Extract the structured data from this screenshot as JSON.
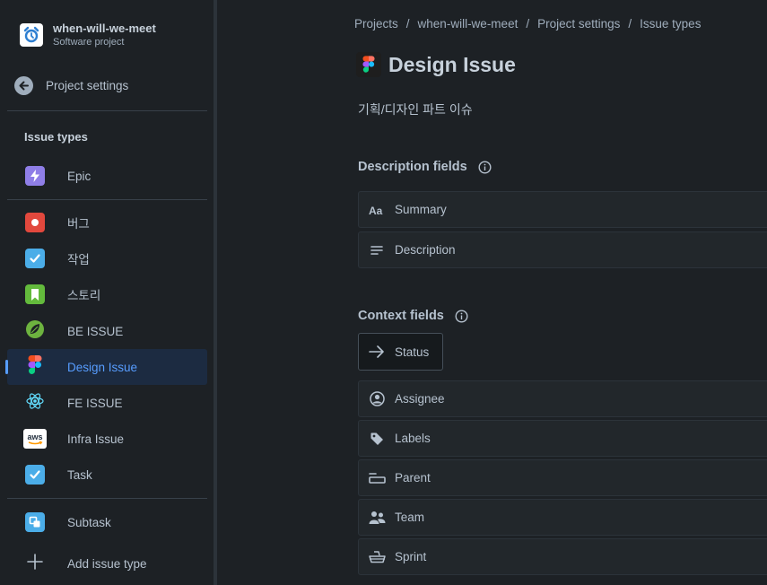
{
  "project": {
    "name": "when-will-we-meet",
    "type": "Software project"
  },
  "sidebar": {
    "back_label": "Project settings",
    "section_title": "Issue types",
    "items": [
      {
        "label": "Epic",
        "icon": "lightning-icon",
        "color": "#8f7ee7"
      },
      {
        "label": "버그",
        "icon": "bug-icon",
        "color": "#e2483d"
      },
      {
        "label": "작업",
        "icon": "checkbox-icon",
        "color": "#4bade8"
      },
      {
        "label": "스토리",
        "icon": "bookmark-icon",
        "color": "#63ba3c"
      },
      {
        "label": "BE ISSUE",
        "icon": "spring-leaf-icon",
        "color": "#6db33f"
      },
      {
        "label": "Design Issue",
        "icon": "figma-icon",
        "selected": true
      },
      {
        "label": "FE ISSUE",
        "icon": "react-icon",
        "color": "#61dafb"
      },
      {
        "label": "Infra Issue",
        "icon": "aws-icon"
      },
      {
        "label": "Task",
        "icon": "checkbox-icon",
        "color": "#4bade8"
      },
      {
        "label": "Subtask",
        "icon": "subtask-icon",
        "color": "#4bade8"
      }
    ],
    "add_label": "Add issue type"
  },
  "breadcrumb": [
    "Projects",
    "when-will-we-meet",
    "Project settings",
    "Issue types"
  ],
  "page": {
    "title": "Design Issue",
    "description": "기획/디자인 파트 이슈"
  },
  "description_fields": {
    "title": "Description fields",
    "items": [
      {
        "label": "Summary",
        "icon": "text-aa-icon"
      },
      {
        "label": "Description",
        "icon": "text-lines-icon"
      }
    ]
  },
  "context_fields": {
    "title": "Context fields",
    "status_label": "Status",
    "items": [
      {
        "label": "Assignee",
        "icon": "person-icon"
      },
      {
        "label": "Labels",
        "icon": "tag-icon"
      },
      {
        "label": "Parent",
        "icon": "parent-icon"
      },
      {
        "label": "Team",
        "icon": "people-icon"
      },
      {
        "label": "Sprint",
        "icon": "sprint-icon"
      }
    ]
  }
}
